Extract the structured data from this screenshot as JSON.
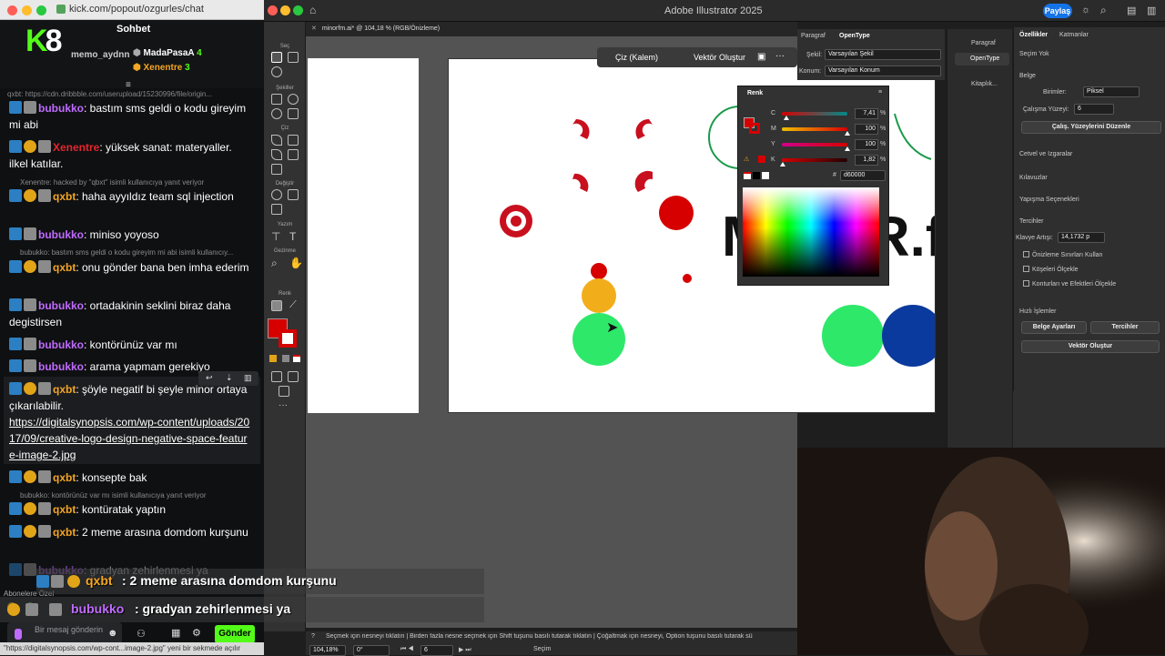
{
  "chat_window": {
    "url": "kick.com/popout/ozgurles/chat",
    "title": "Sohbet",
    "logo_text": "K",
    "logo_number": "8",
    "top_viewers": [
      {
        "name": "memo_aydnn",
        "count": ""
      },
      {
        "name": "MadaPasaA",
        "count": "4"
      },
      {
        "name": "Xenentre",
        "count": "3"
      }
    ],
    "pinned_link": "qxbt: https://cdn.dribbble.com/userupload/15230996/file/origin...",
    "messages": [
      {
        "user": "bubukko",
        "text": ": bastım sms geldi o kodu gireyim mi abi"
      },
      {
        "user": "Xenentre",
        "text": ": yüksek sanat: materyaller. ilkel katılar."
      },
      {
        "reply": "Xenentre: hacked by \"qbxt\" isimli kullanıcıya yanıt veriyor"
      },
      {
        "user": "qxbt",
        "text": ": haha ayyıldız team sql injection"
      },
      {
        "user": "bubukko",
        "text": ": miniso yoyoso"
      },
      {
        "reply": "bubukko: bastım sms geldi o kodu gireyim mi abi isimli kullanıcıy..."
      },
      {
        "user": "qxbt",
        "text": ": onu gönder bana ben imha ederim"
      },
      {
        "user": "bubukko",
        "text": ": ortadakinin seklini biraz daha degistirsen"
      },
      {
        "user": "bubukko",
        "text": ": kontörünüz var mı"
      },
      {
        "user": "bubukko",
        "text": ": arama yapmam gerekiyo"
      },
      {
        "user": "qxbt",
        "text": ": şöyle negatif bi şeyle minor ortaya çıkarılabilir."
      },
      {
        "link": "https://digitalsynopsis.com/wp-content/uploads/2017/09/creative-logo-design-negative-space-feature-image-2.jpg"
      },
      {
        "user": "qxbt",
        "text": ": konsepte bak"
      },
      {
        "reply": "bubukko: kontörünüz var mı isimli kullanıcıya yanıt veriyor"
      },
      {
        "user": "qxbt",
        "text": ": kontüratak yaptın"
      },
      {
        "user": "qxbt",
        "text": ": 2 meme arasına domdom kurşunu"
      },
      {
        "user": "bubukko",
        "text": ": gradyan zehirlenmesi ya"
      }
    ],
    "subscribers_label": "Abonelere Özel",
    "input_placeholder": "Bir mesaj gönderin",
    "send_label": "Gönder",
    "status_url": "\"https://digitalsynopsis.com/wp-cont...image-2.jpg\" yeni bir sekmede açılır"
  },
  "overlay": {
    "line1_user": "qxbt",
    "line1_text": ": 2 meme arasına domdom kurşunu",
    "line2_user": "bubukko",
    "line2_text": ": gradyan zehirlenmesi ya"
  },
  "illustrator": {
    "app_title": "Adobe Illustrator 2025",
    "share_label": "Paylaş",
    "doc_tab": "minorfm.ai* @ 104,18 % (RGB/Önizleme)",
    "tool_sections": [
      "Seç",
      "Şekiller",
      "Çiz",
      "Değiştir",
      "Yazım",
      "Gezinme",
      "Renk"
    ],
    "context_bar": {
      "draw": "Çiz (Kalem)",
      "vector": "Vektör Oluştur"
    },
    "artboard_text": "MINOR.f",
    "type_panel": {
      "tabs": [
        "Paragraf",
        "OpenType"
      ],
      "sekil_label": "Şekil:",
      "sekil_value": "Varsayılan Şekil",
      "konum_label": "Konum:",
      "konum_value": "Varsayılan Konum"
    },
    "mini_dock": [
      "Paragraf",
      "OpenType",
      "Kitaplık..."
    ],
    "properties": {
      "tabs": [
        "Özellikler",
        "Katmanlar"
      ],
      "no_selection": "Seçim Yok",
      "document": "Belge",
      "units_label": "Birimler:",
      "units_value": "Piksel",
      "artboard_label": "Çalışma Yüzeyi:",
      "artboard_value": "6",
      "edit_artboards": "Çalış. Yüzeylerini Düzenle",
      "rulers": "Cetvel ve Izgaralar",
      "guides": "Kılavuzlar",
      "snap": "Yapışma Seçenekleri",
      "preferences": "Tercihler",
      "keyboard_label": "Klavye Artışı:",
      "keyboard_value": "14,1732 p",
      "check1": "Önizleme Sınırları Kullan",
      "check2": "Köşeleri Ölçekle",
      "check3": "Konturları ve Efektleri Ölçekle",
      "quick_actions": "Hızlı İşlemler",
      "doc_setup": "Belge Ayarları",
      "prefs_btn": "Tercihler",
      "vector_btn": "Vektör Oluştur"
    },
    "color_panel": {
      "title": "Renk",
      "sliders": [
        {
          "label": "C",
          "value": "7,41",
          "pos": 0.07
        },
        {
          "label": "M",
          "value": "100",
          "pos": 1.0
        },
        {
          "label": "Y",
          "value": "100",
          "pos": 1.0
        },
        {
          "label": "K",
          "value": "1,82",
          "pos": 0.02
        }
      ],
      "percent": "%",
      "hex_label": "#",
      "hex_value": "d60000"
    },
    "status": {
      "hint": "Seçmek için nesneyi tıklatın | Birden fazla nesne seçmek için Shift tuşunu basılı tutarak tıklatın | Çoğaltmak için nesneyi, Option tuşunu basılı tutarak sü",
      "zoom": "104,18%",
      "angle": "0°",
      "page": "6",
      "tool": "Seçim"
    }
  },
  "colors": {
    "kick_green": "#53fc18",
    "ai_red": "#d60000",
    "green_circle": "#2ee86a",
    "blue_circle": "#0b3a9e",
    "orange_circle": "#f2ad1a"
  }
}
